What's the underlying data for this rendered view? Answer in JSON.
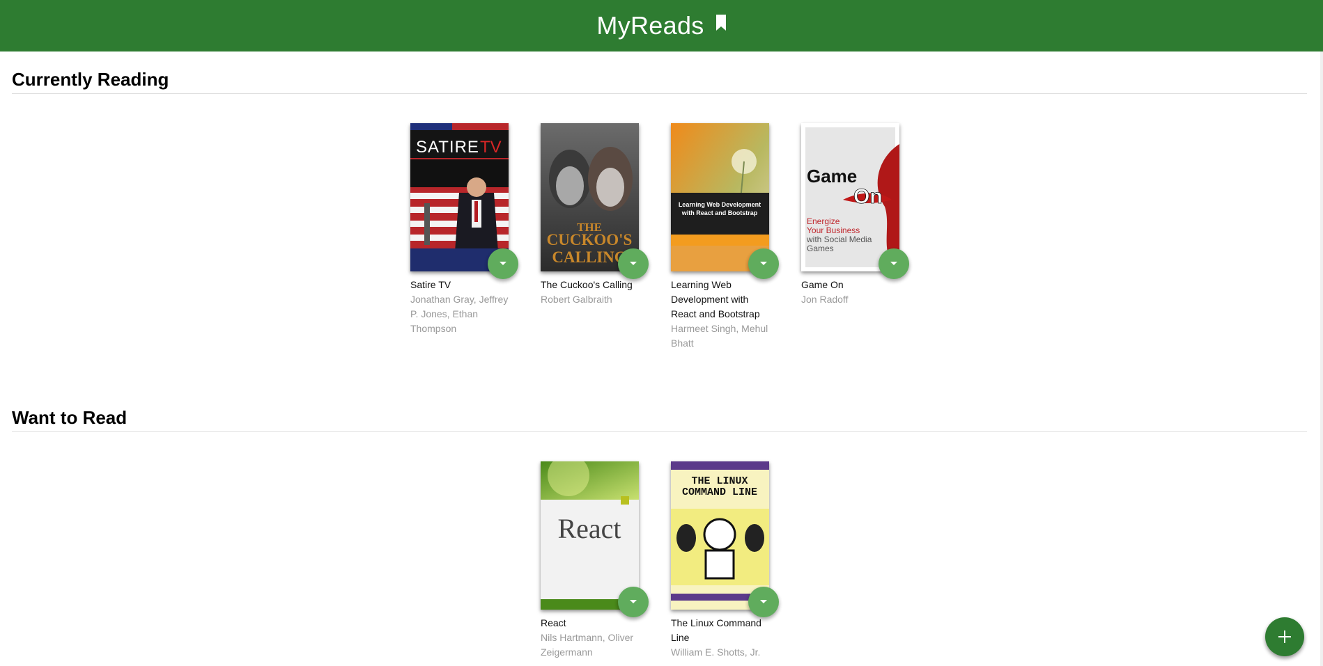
{
  "app": {
    "title": "MyReads",
    "title_icon": "bookmark-icon"
  },
  "shelves": [
    {
      "title": "Currently Reading",
      "books": [
        {
          "title": "Satire TV",
          "authors": "Jonathan Gray, Jeffrey P. Jones, Ethan Thompson",
          "cover_text": "SATIRE TV"
        },
        {
          "title": "The Cuckoo's Calling",
          "authors": "Robert Galbraith",
          "cover_text": "THE CUCKOO'S CALLING"
        },
        {
          "title": "Learning Web Development with React and Bootstrap",
          "authors": "Harmeet Singh, Mehul Bhatt",
          "cover_text": "Learning Web Development with React and Bootstrap"
        },
        {
          "title": "Game On",
          "authors": "Jon Radoff",
          "cover_text": "Game On"
        }
      ]
    },
    {
      "title": "Want to Read",
      "books": [
        {
          "title": "React",
          "authors": "Nils Hartmann, Oliver Zeigermann",
          "cover_text": "React"
        },
        {
          "title": "The Linux Command Line",
          "authors": "William E. Shotts, Jr.",
          "cover_text": "THE LINUX COMMAND LINE"
        }
      ]
    }
  ],
  "controls": {
    "shelf_changer_icon": "caret-down-icon",
    "add_button_icon": "plus-icon"
  },
  "colors": {
    "header": "#2e7c31",
    "shelf_changer": "#60ac5d",
    "add_button": "#2e7c31"
  }
}
